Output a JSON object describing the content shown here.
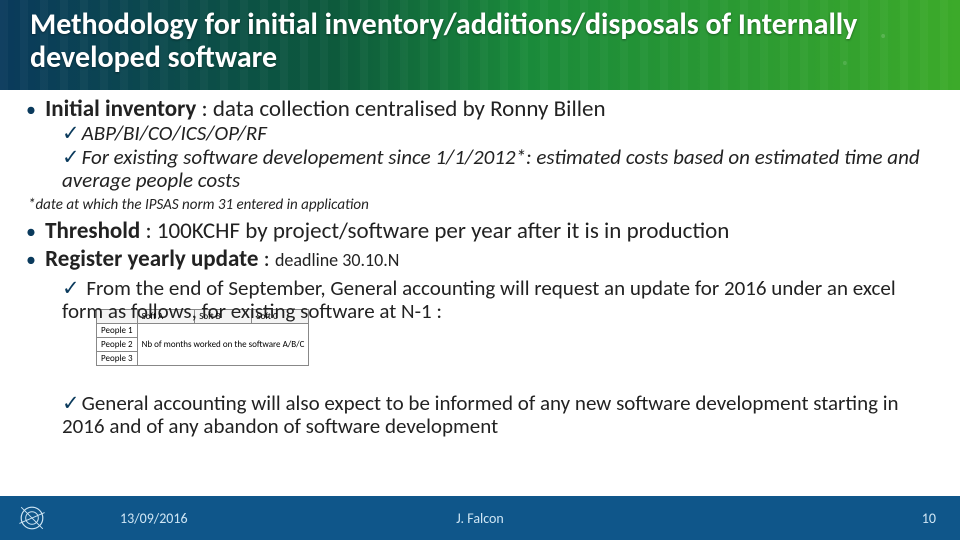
{
  "title": "Methodology for initial inventory/additions/disposals of Internally developed  software",
  "l1_initial_bold": "Initial inventory",
  "l1_initial_rest": " : data collection centralised by Ronny Billen",
  "sub_abp": "ABP/BI/CO/ICS/OP/RF",
  "sub_existing": "For existing software developement since 1/1/2012*: estimated costs based on estimated time and average people costs",
  "note": "*date at which the IPSAS norm 31 entered in application",
  "l1_threshold_bold": "Threshold",
  "l1_threshold_rest": " : 100KCHF by project/software per year after it is in production",
  "l1_register_bold": "Register yearly update",
  "l1_register_rest": " : ",
  "l1_register_small": "deadline 30.10.N",
  "sub_from_sept": " From the end of September, General accounting will request an update for 2016 under an excel form as follows, for existing software at N-1 :",
  "sub_general_acct": "General accounting will also expect to be informed of any new software development starting in 2016 and of any abandon of software development",
  "tbl": {
    "h_blank": "",
    "h_a": "Soft A",
    "h_b": "Soft B",
    "h_c": "Soft C",
    "r1": "People 1",
    "r2": "People 2",
    "r3": "People 3",
    "caption": "Nb of months worked on the software A/B/C"
  },
  "check": "✓",
  "bullet": "•",
  "footer": {
    "date": "13/09/2016",
    "author": "J. Falcon",
    "num": "10"
  }
}
